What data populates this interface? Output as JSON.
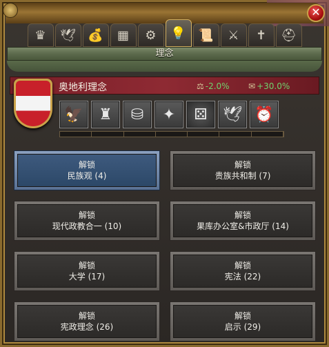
{
  "window": {
    "title": "理念",
    "close_glyph": "✕"
  },
  "tabs": [
    {
      "icon": "crown-icon",
      "glyph": "♛",
      "active": false
    },
    {
      "icon": "dove-icon",
      "glyph": "🕊",
      "active": false
    },
    {
      "icon": "money-bags-icon",
      "glyph": "💰",
      "active": false
    },
    {
      "icon": "crate-icon",
      "glyph": "▦",
      "active": false
    },
    {
      "icon": "gears-icon",
      "glyph": "⚙",
      "active": false
    },
    {
      "icon": "lightbulb-icon",
      "glyph": "💡",
      "active": true
    },
    {
      "icon": "scroll-icon",
      "glyph": "📜",
      "active": false
    },
    {
      "icon": "swords-icon",
      "glyph": "⚔",
      "active": false
    },
    {
      "icon": "cross-icon",
      "glyph": "✝",
      "active": false
    },
    {
      "icon": "helmet-icon",
      "glyph": "⛑",
      "active": false
    }
  ],
  "country": {
    "name": "奥地利理念",
    "stat1": "-2.0%",
    "stat2": "+30.0%",
    "flag_colors": [
      "#c8202a",
      "#f4f4f4",
      "#c8202a"
    ]
  },
  "idea_icons": [
    {
      "icon": "eagle-icon",
      "glyph": "🦅"
    },
    {
      "icon": "castle-icon",
      "glyph": "♜"
    },
    {
      "icon": "coins-icon",
      "glyph": "⛁"
    },
    {
      "icon": "dove-star-icon",
      "glyph": "✦"
    },
    {
      "icon": "dice-icon",
      "glyph": "⚄"
    },
    {
      "icon": "dove-icon",
      "glyph": "🕊"
    },
    {
      "icon": "clock-icon",
      "glyph": "⏰"
    }
  ],
  "unlock_label": "解锁",
  "ideas": [
    {
      "name": "民族观 (4)",
      "selected": true
    },
    {
      "name": "贵族共和制 (7)",
      "selected": false
    },
    {
      "name": "现代政教合一 (10)",
      "selected": false
    },
    {
      "name": "果库办公室&市政厅 (14)",
      "selected": false
    },
    {
      "name": "大学 (17)",
      "selected": false
    },
    {
      "name": "宪法 (22)",
      "selected": false
    },
    {
      "name": "宪政理念 (26)",
      "selected": false
    },
    {
      "name": "启示 (29)",
      "selected": false
    }
  ]
}
